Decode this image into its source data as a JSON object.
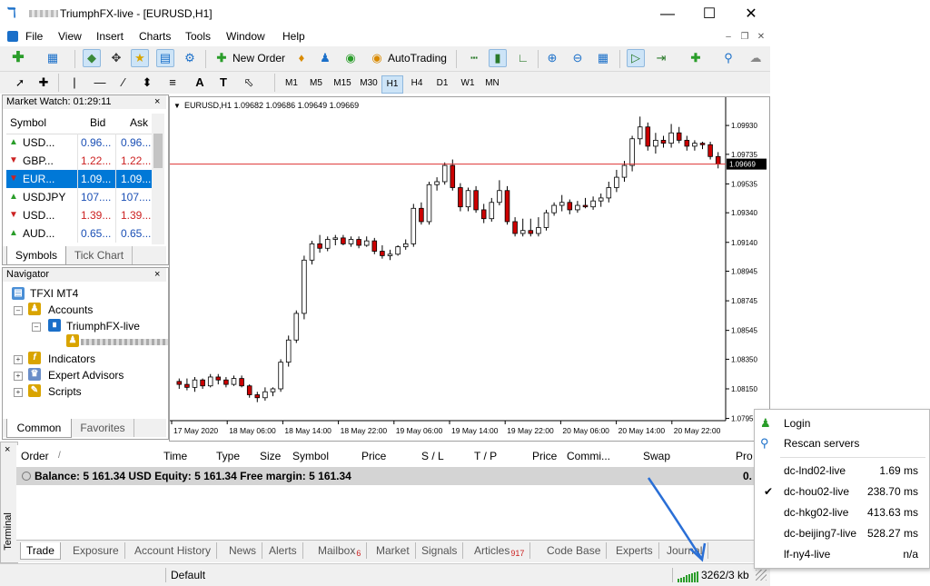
{
  "window": {
    "title": "TriumphFX-live - [EURUSD,H1]"
  },
  "menu": [
    "File",
    "View",
    "Insert",
    "Charts",
    "Tools",
    "Window",
    "Help"
  ],
  "toolbar": {
    "new_order": "New Order",
    "autotrading": "AutoTrading"
  },
  "timeframes": [
    "M1",
    "M5",
    "M15",
    "M30",
    "H1",
    "H4",
    "D1",
    "W1",
    "MN"
  ],
  "timeframe_selected": "H1",
  "market_watch": {
    "title": "Market Watch: 01:29:11",
    "columns": [
      "Symbol",
      "Bid",
      "Ask"
    ],
    "rows": [
      {
        "symbol": "USD...",
        "bid": "0.96...",
        "ask": "0.96...",
        "dir": "up"
      },
      {
        "symbol": "GBP...",
        "bid": "1.22...",
        "ask": "1.22...",
        "dir": "down"
      },
      {
        "symbol": "EUR...",
        "bid": "1.09...",
        "ask": "1.09...",
        "dir": "down"
      },
      {
        "symbol": "USDJPY",
        "bid": "107....",
        "ask": "107....",
        "dir": "up"
      },
      {
        "symbol": "USD...",
        "bid": "1.39...",
        "ask": "1.39...",
        "dir": "down"
      },
      {
        "symbol": "AUD...",
        "bid": "0.65...",
        "ask": "0.65...",
        "dir": "up"
      }
    ],
    "tabs": [
      "Symbols",
      "Tick Chart"
    ]
  },
  "navigator": {
    "title": "Navigator",
    "root": "TFXI MT4",
    "accounts": "Accounts",
    "server": "TriumphFX-live",
    "indicators": "Indicators",
    "experts": "Expert Advisors",
    "scripts": "Scripts",
    "tabs": [
      "Common",
      "Favorites"
    ]
  },
  "chart_data": {
    "type": "candlestick",
    "header": "EURUSD,H1  1.09682 1.09686 1.09649 1.09669",
    "current_price": 1.09669,
    "current_price_label": "1.09669",
    "y_ticks": [
      1.0993,
      1.09735,
      1.09535,
      1.0934,
      1.0914,
      1.08945,
      1.08745,
      1.08545,
      1.0835,
      1.0815,
      1.0795
    ],
    "y_tick_labels": [
      "1.09930",
      "1.09735",
      "1.09535",
      "1.09340",
      "1.09140",
      "1.08945",
      "1.08745",
      "1.08545",
      "1.08350",
      "1.08150",
      "1.0795"
    ],
    "ylim": [
      1.07935,
      1.10035
    ],
    "x_labels": [
      "17 May 2020",
      "18 May 06:00",
      "18 May 14:00",
      "18 May 22:00",
      "19 May 06:00",
      "19 May 14:00",
      "19 May 22:00",
      "20 May 06:00",
      "20 May 14:00",
      "20 May 22:00"
    ],
    "colors": {
      "bull": "#ffffff",
      "bear": "#cc0000",
      "wick": "#000000",
      "price_line": "#dd3333"
    },
    "candles": [
      [
        1.082,
        1.0822,
        1.0815,
        1.0818
      ],
      [
        1.0818,
        1.0822,
        1.0814,
        1.0816
      ],
      [
        1.0816,
        1.0823,
        1.0813,
        1.0821
      ],
      [
        1.0821,
        1.0822,
        1.0815,
        1.0817
      ],
      [
        1.0817,
        1.0825,
        1.0816,
        1.0823
      ],
      [
        1.0823,
        1.0825,
        1.0818,
        1.0821
      ],
      [
        1.0821,
        1.0823,
        1.0816,
        1.0818
      ],
      [
        1.0818,
        1.0824,
        1.0817,
        1.0822
      ],
      [
        1.0822,
        1.0824,
        1.0816,
        1.0817
      ],
      [
        1.0817,
        1.0818,
        1.0809,
        1.0811
      ],
      [
        1.0811,
        1.0813,
        1.0806,
        1.0809
      ],
      [
        1.0809,
        1.0816,
        1.0807,
        1.0813
      ],
      [
        1.0813,
        1.0816,
        1.081,
        1.0815
      ],
      [
        1.0815,
        1.0835,
        1.0813,
        1.0833
      ],
      [
        1.0833,
        1.0851,
        1.083,
        1.0848
      ],
      [
        1.0848,
        1.0868,
        1.0846,
        1.0866
      ],
      [
        1.0866,
        1.0905,
        1.0862,
        1.0902
      ],
      [
        1.0902,
        1.0915,
        1.0899,
        1.0913
      ],
      [
        1.0913,
        1.0919,
        1.0907,
        1.091
      ],
      [
        1.091,
        1.0918,
        1.0908,
        1.0916
      ],
      [
        1.0916,
        1.0919,
        1.0912,
        1.0917
      ],
      [
        1.0917,
        1.0919,
        1.0912,
        1.0913
      ],
      [
        1.0913,
        1.0918,
        1.0911,
        1.0916
      ],
      [
        1.0916,
        1.0918,
        1.091,
        1.0912
      ],
      [
        1.0912,
        1.0918,
        1.0911,
        1.0915
      ],
      [
        1.0915,
        1.0917,
        1.0906,
        1.0908
      ],
      [
        1.0908,
        1.0912,
        1.0903,
        1.0905
      ],
      [
        1.0905,
        1.0909,
        1.0902,
        1.0906
      ],
      [
        1.0906,
        1.0912,
        1.0905,
        1.0911
      ],
      [
        1.0911,
        1.0916,
        1.0909,
        1.0913
      ],
      [
        1.0913,
        1.094,
        1.0911,
        1.0937
      ],
      [
        1.0937,
        1.0941,
        1.0926,
        1.0928
      ],
      [
        1.0928,
        1.0955,
        1.0926,
        1.0953
      ],
      [
        1.0953,
        1.0958,
        1.0949,
        1.0955
      ],
      [
        1.0955,
        1.0968,
        1.0953,
        1.0966
      ],
      [
        1.0966,
        1.097,
        1.0949,
        1.0951
      ],
      [
        1.0951,
        1.0954,
        1.0935,
        1.0938
      ],
      [
        1.0938,
        1.0951,
        1.0935,
        1.0949
      ],
      [
        1.0949,
        1.0952,
        1.0934,
        1.0936
      ],
      [
        1.0936,
        1.094,
        1.0927,
        1.093
      ],
      [
        1.093,
        1.0944,
        1.0928,
        1.0941
      ],
      [
        1.0941,
        1.0956,
        1.0939,
        1.0949
      ],
      [
        1.0949,
        1.0952,
        1.0926,
        1.0928
      ],
      [
        1.0928,
        1.0931,
        1.0918,
        1.092
      ],
      [
        1.092,
        1.093,
        1.0918,
        1.0922
      ],
      [
        1.0922,
        1.093,
        1.0918,
        1.092
      ],
      [
        1.092,
        1.0931,
        1.0918,
        1.0924
      ],
      [
        1.0924,
        1.0936,
        1.0922,
        1.0934
      ],
      [
        1.0934,
        1.0941,
        1.0932,
        1.0939
      ],
      [
        1.0939,
        1.0946,
        1.0935,
        1.0941
      ],
      [
        1.0941,
        1.0943,
        1.0933,
        1.0936
      ],
      [
        1.0936,
        1.0942,
        1.0934,
        1.0939
      ],
      [
        1.0939,
        1.0944,
        1.0937,
        1.0938
      ],
      [
        1.0938,
        1.0945,
        1.0936,
        1.0942
      ],
      [
        1.0942,
        1.0947,
        1.0938,
        1.0944
      ],
      [
        1.0944,
        1.0955,
        1.0941,
        1.0951
      ],
      [
        1.0951,
        1.0963,
        1.0948,
        1.0958
      ],
      [
        1.0958,
        1.0969,
        1.0955,
        1.0966
      ],
      [
        1.0966,
        1.0986,
        1.0962,
        1.0984
      ],
      [
        1.0984,
        1.0999,
        1.098,
        1.0992
      ],
      [
        1.0992,
        1.0995,
        1.0976,
        1.0979
      ],
      [
        1.0979,
        1.0988,
        1.0974,
        1.0983
      ],
      [
        1.0983,
        1.0986,
        1.0978,
        1.0981
      ],
      [
        1.0981,
        1.0994,
        1.0978,
        1.0988
      ],
      [
        1.0988,
        1.0992,
        1.0981,
        1.0983
      ],
      [
        1.0983,
        1.0986,
        1.0976,
        1.0979
      ],
      [
        1.0979,
        1.0983,
        1.0976,
        1.0981
      ],
      [
        1.0981,
        1.0982,
        1.0977,
        1.098
      ],
      [
        1.098,
        1.0982,
        1.097,
        1.0972
      ],
      [
        1.0972,
        1.0975,
        1.0964,
        1.0967
      ]
    ]
  },
  "terminal": {
    "label": "Terminal",
    "columns": [
      "Order",
      "/",
      "Time",
      "Type",
      "Size",
      "Symbol",
      "Price",
      "S / L",
      "T / P",
      "Price",
      "Commi...",
      "Swap",
      "Pro"
    ],
    "balance_text": "Balance: 5 161.34 USD  Equity: 5 161.34  Free margin: 5 161.34",
    "profit_partial": "0.",
    "tabs": [
      {
        "label": "Trade",
        "badge": ""
      },
      {
        "label": "Exposure",
        "badge": ""
      },
      {
        "label": "Account History",
        "badge": ""
      },
      {
        "label": "News",
        "badge": ""
      },
      {
        "label": "Alerts",
        "badge": ""
      },
      {
        "label": "Mailbox",
        "badge": "6"
      },
      {
        "label": "Market",
        "badge": ""
      },
      {
        "label": "Signals",
        "badge": ""
      },
      {
        "label": "Articles",
        "badge": "917"
      },
      {
        "label": "Code Base",
        "badge": ""
      },
      {
        "label": "Experts",
        "badge": ""
      },
      {
        "label": "Journal",
        "badge": ""
      }
    ]
  },
  "statusbar": {
    "profile": "Default",
    "traffic": "3262/3 kb"
  },
  "server_popup": {
    "login": "Login",
    "rescan": "Rescan servers",
    "servers": [
      {
        "name": "dc-lnd02-live",
        "ping": "1.69 ms",
        "checked": false
      },
      {
        "name": "dc-hou02-live",
        "ping": "238.70 ms",
        "checked": true
      },
      {
        "name": "dc-hkg02-live",
        "ping": "413.63 ms",
        "checked": false
      },
      {
        "name": "dc-beijing7-live",
        "ping": "528.27 ms",
        "checked": false
      },
      {
        "name": "lf-ny4-live",
        "ping": "n/a",
        "checked": false
      }
    ]
  }
}
